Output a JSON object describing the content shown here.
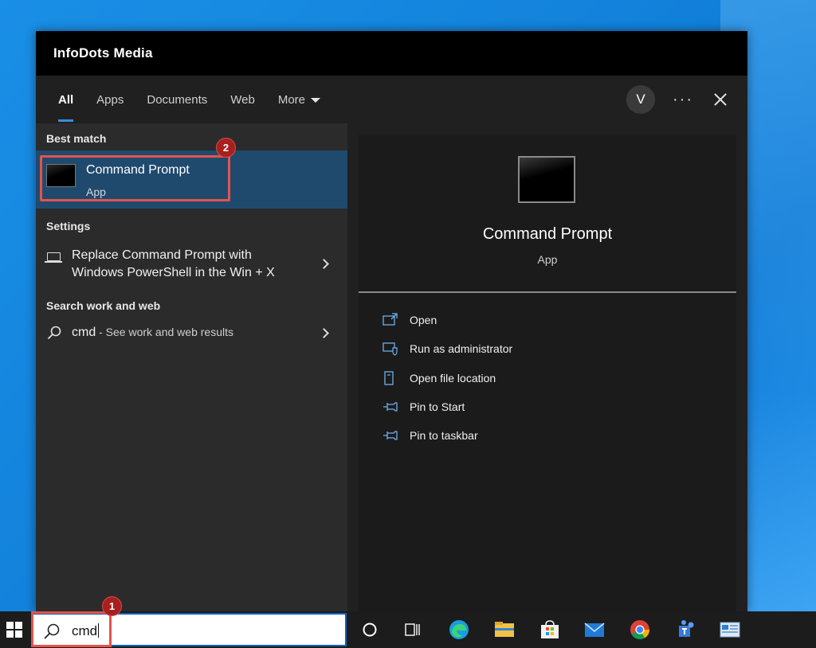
{
  "window": {
    "title": "InfoDots Media"
  },
  "tabs": [
    {
      "label": "All",
      "active": true
    },
    {
      "label": "Apps",
      "active": false
    },
    {
      "label": "Documents",
      "active": false
    },
    {
      "label": "Web",
      "active": false
    },
    {
      "label": "More",
      "active": false
    }
  ],
  "user": {
    "initial": "V"
  },
  "toolbar": {
    "more_options": "···"
  },
  "best_match": {
    "heading": "Best match",
    "title": "Command Prompt",
    "subtitle": "App",
    "annotation": "2"
  },
  "settings": {
    "heading": "Settings",
    "item": "Replace Command Prompt with Windows PowerShell in the Win + X"
  },
  "search_work_web": {
    "heading": "Search work and web",
    "query": "cmd",
    "suffix": " - See work and web results"
  },
  "preview": {
    "title": "Command Prompt",
    "subtitle": "App",
    "actions": [
      {
        "label": "Open",
        "icon": "open-icon"
      },
      {
        "label": "Run as administrator",
        "icon": "shield-icon"
      },
      {
        "label": "Open file location",
        "icon": "file-location-icon"
      },
      {
        "label": "Pin to Start",
        "icon": "pin-icon"
      },
      {
        "label": "Pin to taskbar",
        "icon": "pin-icon"
      }
    ]
  },
  "taskbar": {
    "search_value": "cmd",
    "annotation": "1",
    "icons": [
      "cortana-icon",
      "task-view-icon",
      "edge-icon",
      "file-explorer-icon",
      "store-icon",
      "mail-icon",
      "chrome-icon",
      "teams-icon",
      "control-panel-icon"
    ]
  },
  "colors": {
    "accent": "#3b8edc",
    "selected_bg": "#1f4a6e",
    "annotation_box": "#e5534b",
    "annotation_badge": "#a81f1f"
  }
}
